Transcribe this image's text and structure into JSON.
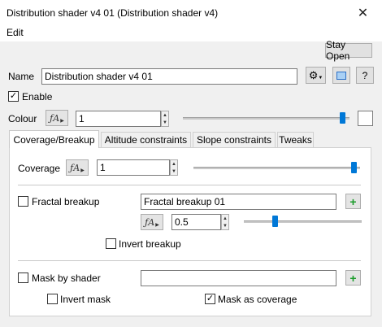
{
  "window": {
    "title": "Distribution shader v4 01    (Distribution shader v4)",
    "close_glyph": "✕"
  },
  "menu": {
    "edit": "Edit"
  },
  "toolbar": {
    "stay_open": "Stay Open",
    "help": "?"
  },
  "name": {
    "label": "Name",
    "value": "Distribution shader v4 01"
  },
  "enable": {
    "label": "Enable",
    "checked": true
  },
  "colour": {
    "label": "Colour",
    "value": "1",
    "slider_fraction": 0.98
  },
  "tabs": [
    {
      "label": "Coverage/Breakup",
      "active": true
    },
    {
      "label": "Altitude constraints",
      "active": false
    },
    {
      "label": "Slope constraints",
      "active": false
    },
    {
      "label": "Tweaks",
      "active": false
    }
  ],
  "coverage": {
    "label": "Coverage",
    "value": "1",
    "slider_fraction": 1.0
  },
  "fractal": {
    "label": "Fractal breakup",
    "checked": false,
    "shader": "Fractal breakup 01",
    "value": "0.5",
    "slider_fraction": 0.25
  },
  "invert_breakup": {
    "label": "Invert breakup",
    "checked": false
  },
  "mask": {
    "label": "Mask by shader",
    "checked": false,
    "shader": ""
  },
  "invert_mask": {
    "label": "Invert mask",
    "checked": false
  },
  "mask_as_coverage": {
    "label": "Mask as coverage",
    "checked": true
  },
  "icons": {
    "check": "✓",
    "up": "▲",
    "down": "▼",
    "func": "ƒA",
    "plus": "+"
  }
}
